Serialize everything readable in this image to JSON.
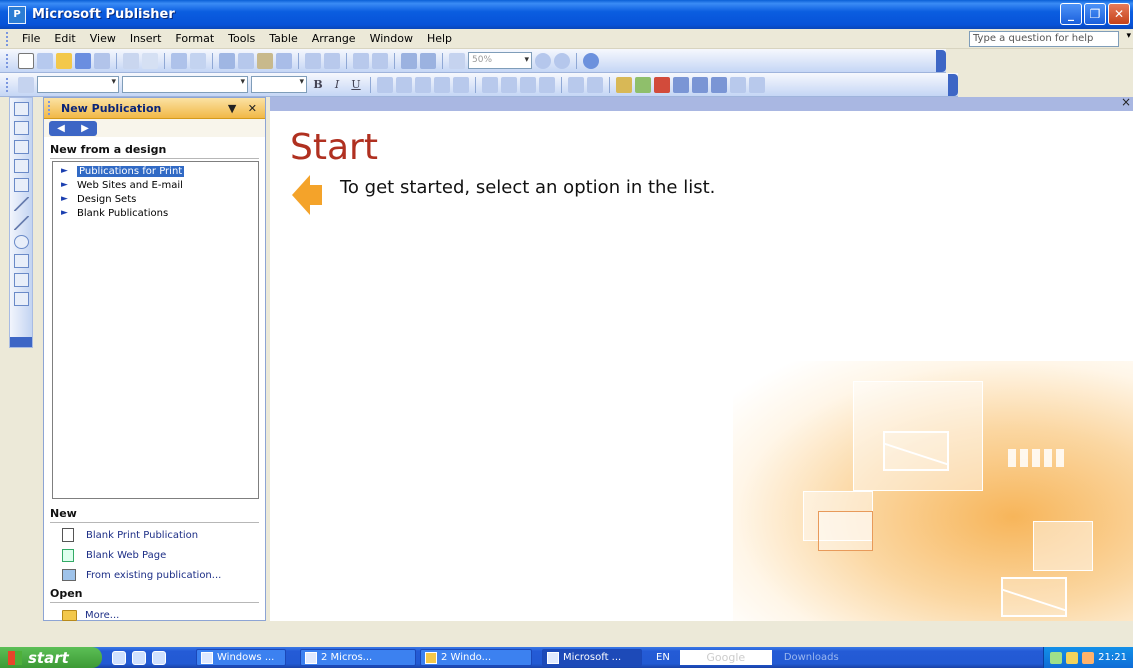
{
  "window": {
    "title": "Microsoft Publisher",
    "app_icon": "publisher-icon"
  },
  "window_controls": {
    "minimize": "_",
    "maximize": "❐",
    "close": "✕"
  },
  "menubar": {
    "items": [
      "File",
      "Edit",
      "View",
      "Insert",
      "Format",
      "Tools",
      "Table",
      "Arrange",
      "Window",
      "Help"
    ],
    "help_placeholder": "Type a question for help"
  },
  "toolbar": {
    "zoom": "50%",
    "bold": "B",
    "italic": "I",
    "underline": "U"
  },
  "taskpane": {
    "title": "New Publication",
    "dropdown_glyph": "▼",
    "close_glyph": "✕",
    "back_glyph": "◀",
    "forward_glyph": "▶",
    "new_from_design": "New from a design",
    "design_items": [
      "Publications for Print",
      "Web Sites and E-mail",
      "Design Sets",
      "Blank Publications"
    ],
    "new_title": "New",
    "new_items": [
      "Blank Print Publication",
      "Blank Web Page",
      "From existing publication..."
    ],
    "open_title": "Open",
    "open_items": [
      "More..."
    ]
  },
  "main": {
    "start_title": "Start",
    "start_message": "To get started, select an option in the list.",
    "close_glyph": "×"
  },
  "taskbar": {
    "start_label": "start",
    "buttons": [
      "Windows ...",
      "2 Micros...",
      "2 Windo...",
      "Microsoft ..."
    ],
    "lang": "EN",
    "google_text": "Google",
    "downloads": "Downloads",
    "clock": "21:21"
  },
  "colors": {
    "title_blue": "#0752d8",
    "taskpane_header": "#f1b847",
    "start_red": "#b03020",
    "arrow_orange": "#f4a32a"
  }
}
